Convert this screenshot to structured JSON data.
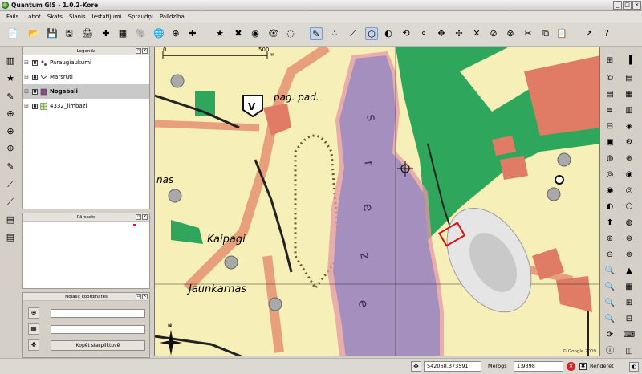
{
  "window": {
    "title": "Quantum GIS - 1.0.2-Kore",
    "min": "_",
    "max": "□",
    "close": "×"
  },
  "menu": [
    "Fails",
    "Labot",
    "Skats",
    "Slānis",
    "Iestatījumi",
    "Spraudņi",
    "Palīdzība"
  ],
  "toolbar_icons": [
    "new-file-icon",
    "open-icon",
    "save-icon",
    "save-as-icon",
    "print-icon",
    "add-vector-icon",
    "add-raster-icon",
    "add-postgis-icon",
    "add-wms-icon",
    "add-gps-icon",
    "new-layer-icon",
    "edit-icon",
    "capture-point-icon",
    "capture-line-icon",
    "capture-polygon-icon",
    "pan-icon",
    "zoom-in-icon",
    "zoom-out-icon",
    "identify-icon",
    "select-icon",
    "measure-icon",
    "bookmark-icon",
    "help-icon"
  ],
  "legend": {
    "title": "Leģenda",
    "layers": [
      {
        "name": "Paraugiaukumi",
        "checked": "✖"
      },
      {
        "name": "Marsruti",
        "checked": "✖"
      },
      {
        "name": "Nogabali",
        "checked": "✖"
      },
      {
        "name": "4332_limbazi",
        "checked": "✖"
      }
    ]
  },
  "overview": {
    "title": "Pārskats"
  },
  "coords_panel": {
    "title": "Nolasīt koordinātes",
    "field1": "",
    "field2": "",
    "copy_button": "Kopēt starpliktuvē"
  },
  "map": {
    "scale_start": "0",
    "scale_end": "500",
    "scale_unit": "m",
    "labels": [
      "pag. pad.",
      "nas",
      "Kaipagi",
      "Jaunkarnas"
    ],
    "lake_letters": [
      "s",
      "r",
      "e",
      "z",
      "e"
    ],
    "copyright": "© Google 2009",
    "north": "N"
  },
  "status": {
    "coordinates": "542068,373591",
    "scale_label": "Mērogs",
    "scale_value": "1:9398",
    "render_label": "Renderēt"
  },
  "colors": {
    "lake": "#a58fbe",
    "road": "#e8a07c",
    "forest": "#2ea65b",
    "building": "#e07b66",
    "field": "#f6efb7"
  }
}
